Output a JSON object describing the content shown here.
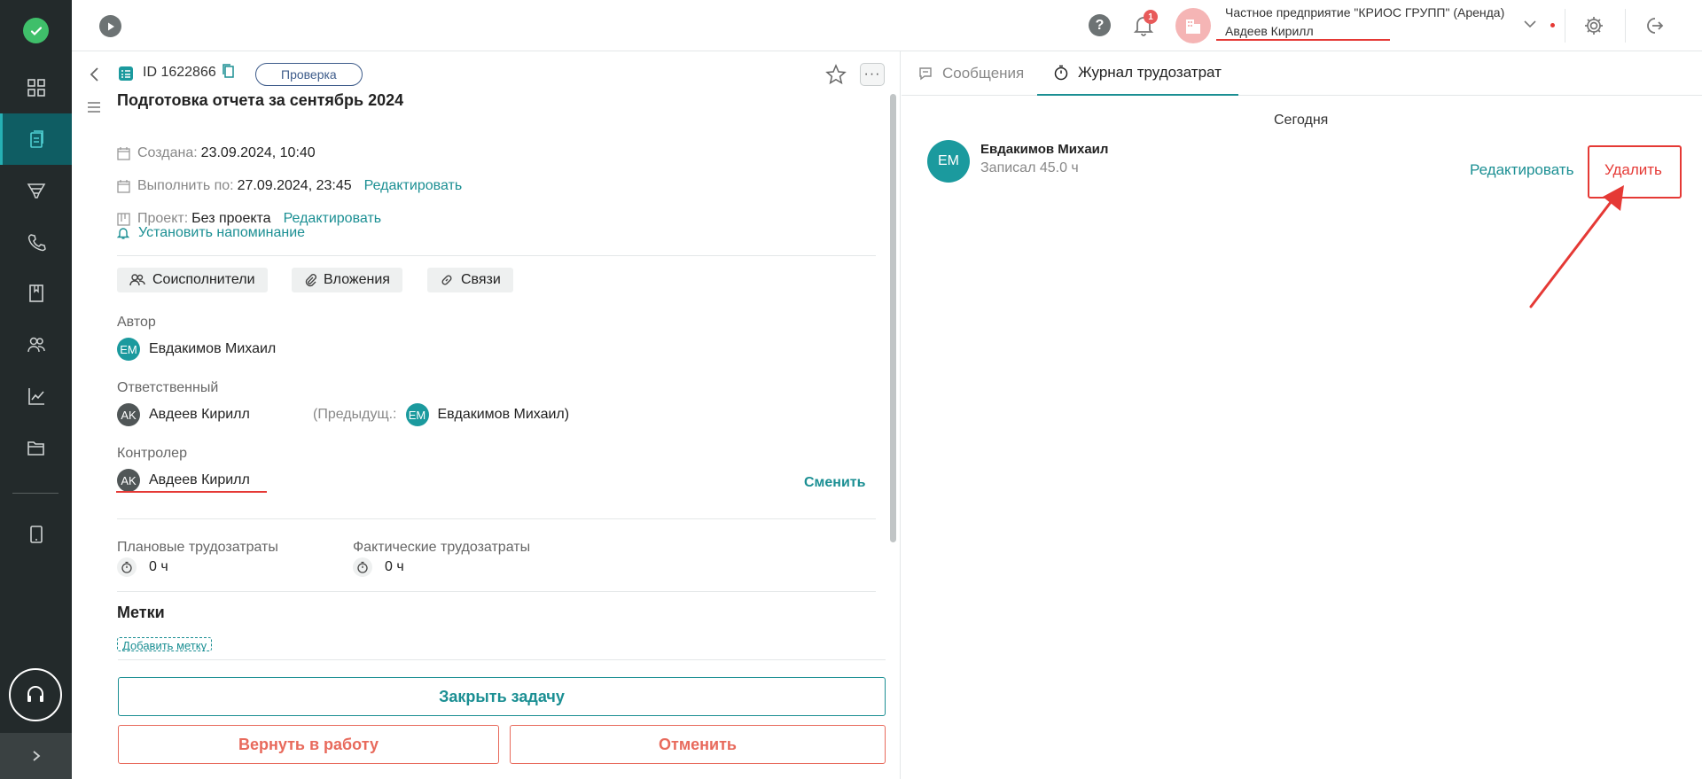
{
  "sidebar": {
    "items": [
      {
        "icon": "dashboard-icon",
        "active": false
      },
      {
        "icon": "tasks-icon",
        "active": true
      },
      {
        "icon": "funnel-icon",
        "active": false
      },
      {
        "icon": "phone-icon",
        "active": false
      },
      {
        "icon": "book-icon",
        "active": false
      },
      {
        "icon": "people-icon",
        "active": false
      },
      {
        "icon": "chart-icon",
        "active": false
      },
      {
        "icon": "folder-icon",
        "active": false
      },
      {
        "icon": "mobile-icon",
        "active": false
      }
    ],
    "support_icon": "headset-icon",
    "expand_icon": "chevron-right-icon"
  },
  "topbar": {
    "notification_count": "1",
    "org_name": "Частное предприятие \"КРИОС ГРУПП\" (Аренда)",
    "user_name": "Авдеев Кирилл"
  },
  "task": {
    "id": "ID 1622866",
    "status": "Проверка",
    "title": "Подготовка отчета за сентябрь 2024",
    "created_label": "Создана:",
    "created_value": "23.09.2024, 10:40",
    "due_label": "Выполнить по:",
    "due_value": "27.09.2024, 23:45",
    "edit_label": "Редактировать",
    "project_label": "Проект:",
    "project_value": "Без проекта",
    "reminder": "Установить напоминание",
    "chips": {
      "coexecutors": "Соисполнители",
      "attachments": "Вложения",
      "links": "Связи"
    },
    "author_label": "Автор",
    "author": {
      "initials": "EM",
      "name": "Евдакимов Михаил"
    },
    "responsible_label": "Ответственный",
    "responsible": {
      "initials": "AK",
      "name": "Авдеев Кирилл"
    },
    "previous_label": "(Предыдущ.:",
    "previous": {
      "initials": "EM",
      "name": "Евдакимов Михаил)"
    },
    "controller_label": "Контролер",
    "controller": {
      "initials": "AK",
      "name": "Авдеев Кирилл"
    },
    "change_label": "Сменить",
    "planned_label": "Плановые трудозатраты",
    "planned_value": "0 ч",
    "actual_label": "Фактические трудозатраты",
    "actual_value": "0 ч",
    "tags_title": "Метки",
    "add_tag": "Добавить метку",
    "buttons": {
      "close": "Закрыть задачу",
      "return": "Вернуть в работу",
      "cancel": "Отменить"
    }
  },
  "right": {
    "tabs": {
      "messages": "Сообщения",
      "timelog": "Журнал трудозатрат"
    },
    "day_label": "Сегодня",
    "entry": {
      "initials": "EM",
      "name": "Евдакимов Михаил",
      "desc": "Записал 45.0 ч",
      "edit": "Редактировать",
      "delete": "Удалить"
    }
  },
  "colors": {
    "accent": "#1b8f93",
    "danger": "#e53935",
    "sidebar": "#232a2b"
  }
}
